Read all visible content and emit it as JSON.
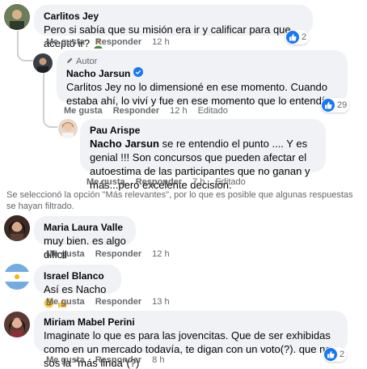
{
  "labels": {
    "like": "Me gusta",
    "reply": "Responder",
    "edited": "Editado"
  },
  "comments": [
    {
      "author": "Carlitos Jey",
      "text": "Pero si sabía que su misión era ir y calificar para que aceptó ir?",
      "time": "12 h",
      "reactions": "2"
    },
    {
      "author_badge": "Autor",
      "author": "Nacho Jarsun",
      "text": "Carlitos Jey no lo dimensioné en ese momento. Cuando estaba ahí, lo viví y fue en ese momento que lo entendí.",
      "time": "12 h",
      "reactions": "29"
    },
    {
      "author": "Pau Arispe",
      "tagged": "Nacho Jarsun",
      "text_line1": " se re entendio el punto .... Y es genial !!!",
      "text_rest": "Son concursos que pueden afectar el autoestima de las participantes que no ganan y más...pero excelente decisión.",
      "time": "7 h"
    },
    {
      "author": "Maria Laura Valle",
      "text": "muy bien. es algo dificil",
      "time": "12 h"
    },
    {
      "author": "Israel Blanco",
      "text": "Así es Nacho",
      "time": "13 h"
    },
    {
      "author": "Miriam Mabel Perini",
      "text": "Imaginate lo que es para las jovencitas. Que de ser exhibidas como en un mercado todavía, te digan con un voto(?). que no sos la \"más linda\"(?)",
      "time": "8 h",
      "reactions": "2"
    }
  ],
  "notice": "Se seleccionó la opción \"Más relevantes\", por lo que es posible que algunas respuestas se hayan filtrado.",
  "colors": {
    "link_blue": "#1877f2",
    "bubble_bg": "#f0f2f5",
    "secondary_text": "#65676b"
  }
}
